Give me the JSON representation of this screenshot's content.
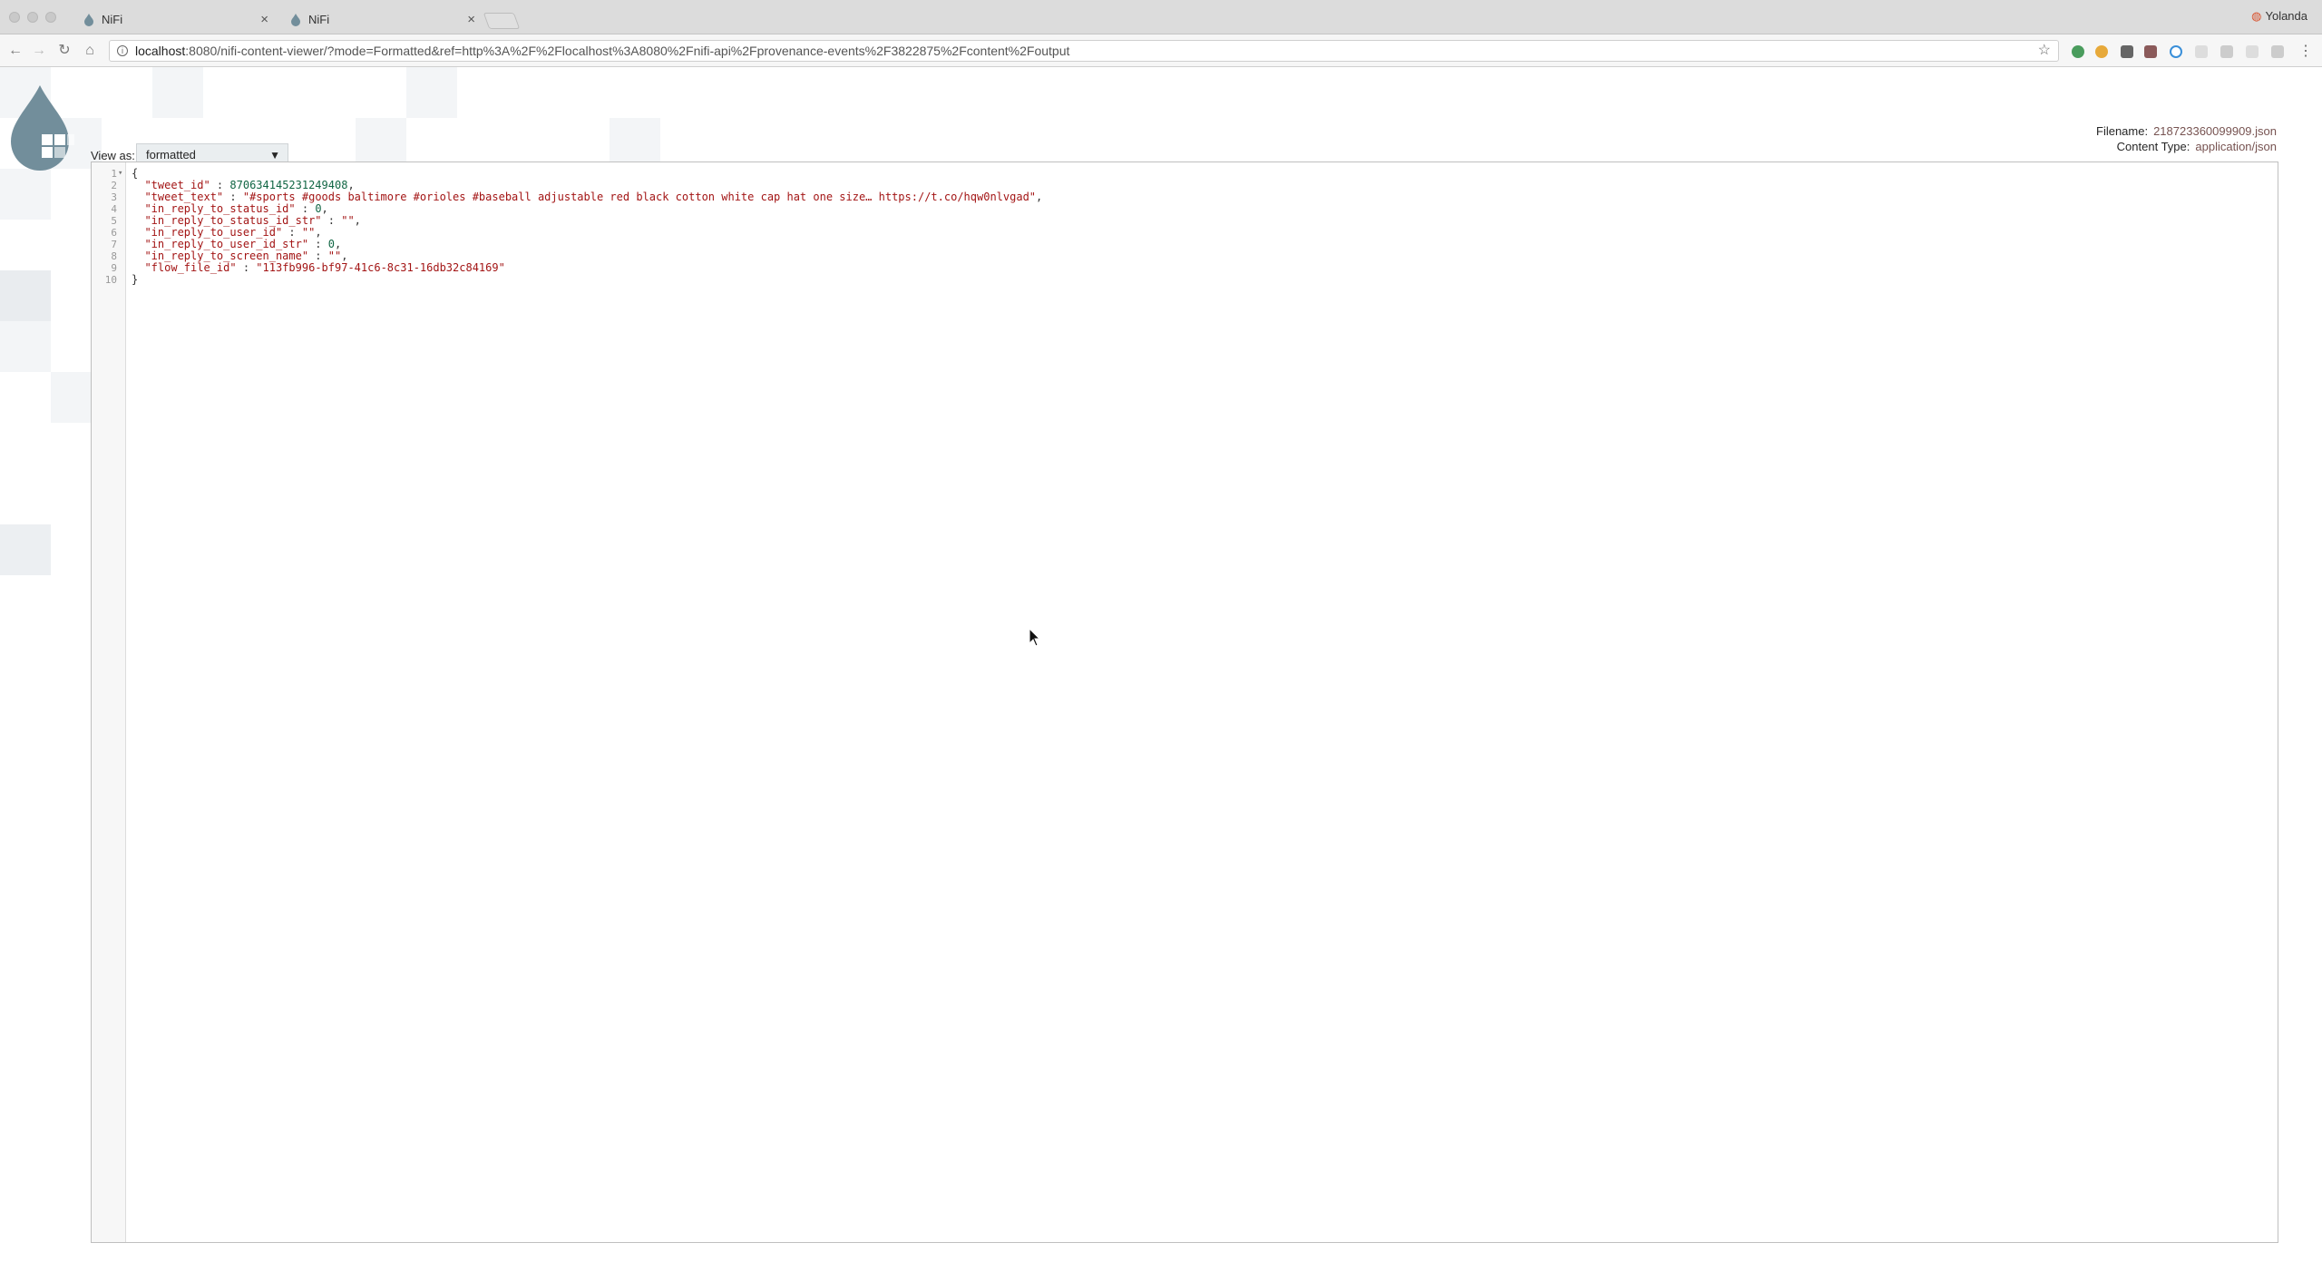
{
  "browser": {
    "tabs": [
      {
        "title": "NiFi",
        "active": false
      },
      {
        "title": "NiFi",
        "active": true
      }
    ],
    "profile_name": "Yolanda",
    "url_host": "localhost",
    "url_rest": ":8080/nifi-content-viewer/?mode=Formatted&ref=http%3A%2F%2Flocalhost%3A8080%2Fnifi-api%2Fprovenance-events%2F3822875%2Fcontent%2Foutput",
    "icons": [
      "back-icon",
      "forward-icon",
      "reload-icon",
      "home-icon",
      "info-icon",
      "star-icon",
      "menu-icon"
    ]
  },
  "viewer": {
    "view_as_label": "View as:",
    "view_mode": "formatted",
    "filename_label": "Filename:",
    "filename": "218723360099909.json",
    "content_type_label": "Content Type:",
    "content_type": "application/json"
  },
  "code": {
    "line_numbers": [
      "1",
      "2",
      "3",
      "4",
      "5",
      "6",
      "7",
      "8",
      "9",
      "10"
    ],
    "open_brace": "{",
    "close_brace": "}",
    "fields": [
      {
        "key": "\"tweet_id\"",
        "sep": " : ",
        "value": "870634145231249408",
        "kind": "num",
        "trail": ","
      },
      {
        "key": "\"tweet_text\"",
        "sep": " : ",
        "value": "\"#sports #goods baltimore #orioles #baseball adjustable red black cotton white cap hat one size… https://t.co/hqw0nlvgad\"",
        "kind": "str",
        "trail": ","
      },
      {
        "key": "\"in_reply_to_status_id\"",
        "sep": " : ",
        "value": "0",
        "kind": "num",
        "trail": ","
      },
      {
        "key": "\"in_reply_to_status_id_str\"",
        "sep": " : ",
        "value": "\"\"",
        "kind": "str",
        "trail": ","
      },
      {
        "key": "\"in_reply_to_user_id\"",
        "sep": " : ",
        "value": "\"\"",
        "kind": "str",
        "trail": ","
      },
      {
        "key": "\"in_reply_to_user_id_str\"",
        "sep": " : ",
        "value": "0",
        "kind": "num",
        "trail": ","
      },
      {
        "key": "\"in_reply_to_screen_name\"",
        "sep": " : ",
        "value": "\"\"",
        "kind": "str",
        "trail": ","
      },
      {
        "key": "\"flow_file_id\"",
        "sep": " : ",
        "value": "\"113fb996-bf97-41c6-8c31-16db32c84169\"",
        "kind": "str",
        "trail": ""
      }
    ]
  },
  "colors": {
    "accent": "#728e9b",
    "meta_value": "#775351",
    "string": "#a31515",
    "number": "#116644"
  }
}
